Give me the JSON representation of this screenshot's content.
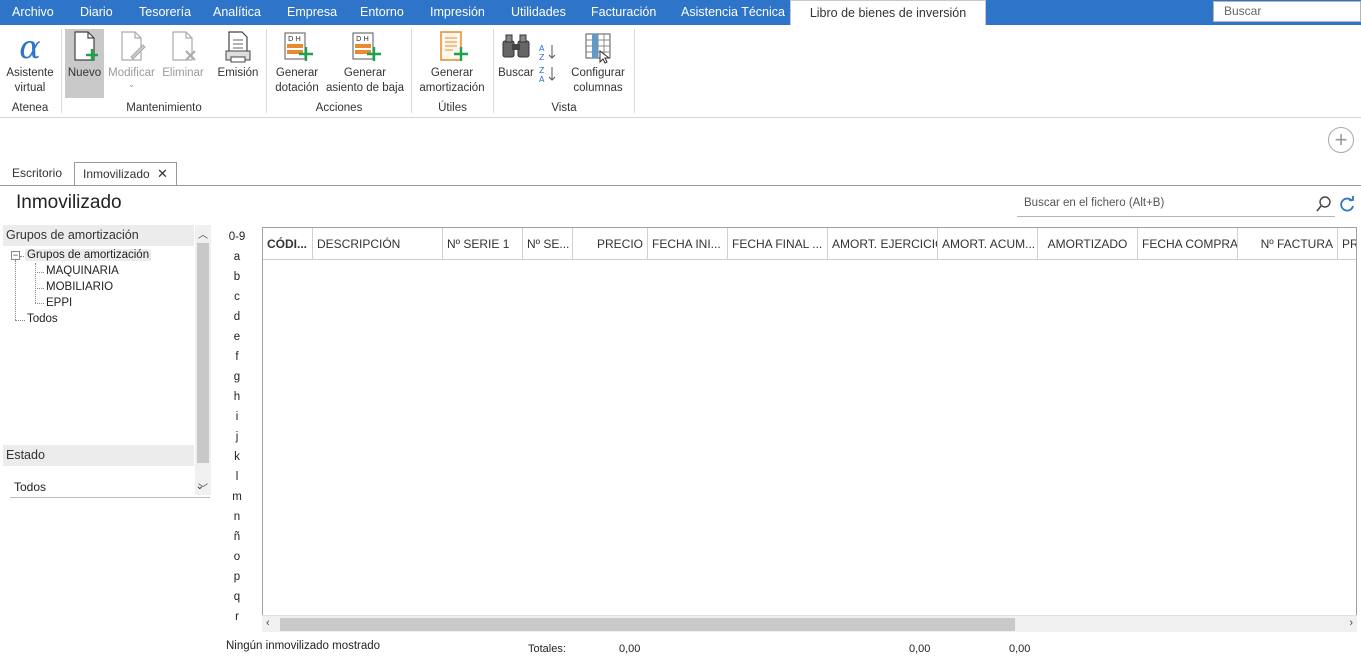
{
  "menu": {
    "items": [
      "Archivo",
      "Diario",
      "Tesorería",
      "Analítica",
      "Empresa",
      "Entorno",
      "Impresión",
      "Utilidades",
      "Facturación",
      "Asistencia Técnica"
    ],
    "active_tab": "Libro de bienes de inversión",
    "search_placeholder": "Buscar"
  },
  "ribbon": {
    "asistente": "Asistente virtual",
    "nuevo": "Nuevo",
    "modificar": "Modificar",
    "eliminar": "Eliminar",
    "emision": "Emisión",
    "generar_dotacion": "Generar dotación",
    "generar_baja": "Generar asiento de baja",
    "generar_amort": "Generar amortización",
    "buscar": "Buscar",
    "configurar": "Configurar columnas",
    "groups": {
      "atenea": "Atenea",
      "mantenimiento": "Mantenimiento",
      "acciones": "Acciones",
      "utiles": "Útiles",
      "vista": "Vista"
    }
  },
  "tabs": {
    "escritorio": "Escritorio",
    "inmovilizado": "Inmovilizado"
  },
  "page": {
    "title": "Inmovilizado",
    "search_placeholder": "Buscar en el fichero (Alt+B)"
  },
  "left_panel": {
    "groups_header": "Grupos de amortización",
    "tree_root": "Grupos de amortización",
    "tree_children": [
      "MAQUINARIA",
      "MOBILIARIO",
      "EPPI"
    ],
    "tree_all": "Todos",
    "estado_header": "Estado",
    "estado_value": "Todos"
  },
  "alphabet": [
    "0-9",
    "a",
    "b",
    "c",
    "d",
    "e",
    "f",
    "g",
    "h",
    "i",
    "j",
    "k",
    "l",
    "m",
    "n",
    "ñ",
    "o",
    "p",
    "q",
    "r"
  ],
  "grid": {
    "columns": [
      "CÓDI...",
      "DESCRIPCIÓN",
      "Nº SERIE 1",
      "Nº SE...",
      "PRECIO",
      "FECHA INI...",
      "FECHA FINAL ...",
      "AMORT. EJERCICIO",
      "AMORT. ACUM...",
      "AMORTIZADO",
      "FECHA COMPRA",
      "Nº FACTURA",
      "PR"
    ]
  },
  "footer": {
    "status": "Ningún inmovilizado mostrado",
    "totals_label": "Totales:",
    "total_precio": "0,00",
    "total_ejercicio": "0,00",
    "total_acum": "0,00"
  }
}
